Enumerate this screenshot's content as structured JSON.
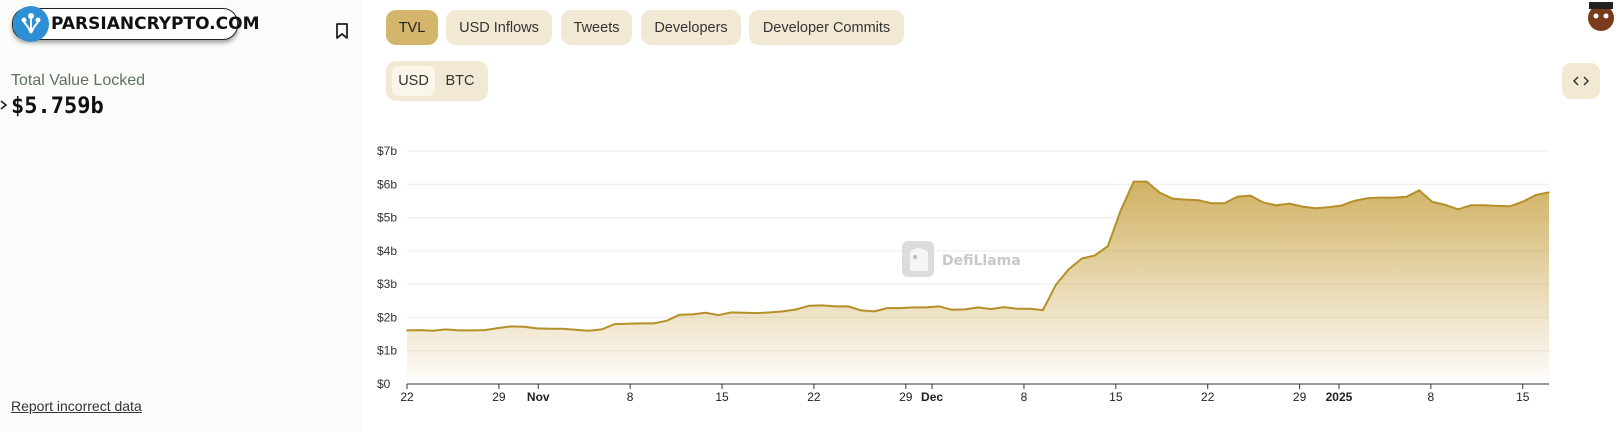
{
  "watermark": {
    "text": "PARSIANCRYPTO.COM"
  },
  "summary": {
    "label": "Total Value Locked",
    "value": "$5.759b"
  },
  "report_link": "Report incorrect data",
  "tabs": [
    {
      "label": "TVL",
      "active": true
    },
    {
      "label": "USD Inflows",
      "active": false
    },
    {
      "label": "Tweets",
      "active": false
    },
    {
      "label": "Developers",
      "active": false
    },
    {
      "label": "Developer Commits",
      "active": false
    }
  ],
  "currency": {
    "options": [
      "USD",
      "BTC"
    ],
    "selected": "USD"
  },
  "chart_watermark": "DefiLlama",
  "colors": {
    "accent": "#b68f28",
    "tab_bg": "#f1e9d3",
    "tab_active": "#d3b66c"
  },
  "chart_data": {
    "type": "area",
    "ylim": [
      0,
      7
    ],
    "y_ticks": [
      "$0",
      "$1b",
      "$2b",
      "$3b",
      "$4b",
      "$5b",
      "$6b",
      "$7b"
    ],
    "x_ticks": [
      {
        "label": "22",
        "day": 0,
        "bold": false
      },
      {
        "label": "29",
        "day": 7,
        "bold": false
      },
      {
        "label": "Nov",
        "day": 10,
        "bold": true
      },
      {
        "label": "8",
        "day": 17,
        "bold": false
      },
      {
        "label": "15",
        "day": 24,
        "bold": false
      },
      {
        "label": "22",
        "day": 31,
        "bold": false
      },
      {
        "label": "29",
        "day": 38,
        "bold": false
      },
      {
        "label": "Dec",
        "day": 40,
        "bold": true
      },
      {
        "label": "8",
        "day": 47,
        "bold": false
      },
      {
        "label": "15",
        "day": 54,
        "bold": false
      },
      {
        "label": "22",
        "day": 61,
        "bold": false
      },
      {
        "label": "29",
        "day": 68,
        "bold": false
      },
      {
        "label": "2025",
        "day": 71,
        "bold": true
      },
      {
        "label": "8",
        "day": 78,
        "bold": false
      },
      {
        "label": "15",
        "day": 85,
        "bold": false
      }
    ],
    "x_last_day": 87,
    "series": [
      {
        "values": [
          1.61,
          1.62,
          1.6,
          1.64,
          1.61,
          1.61,
          1.62,
          1.68,
          1.73,
          1.72,
          1.67,
          1.66,
          1.66,
          1.63,
          1.6,
          1.64,
          1.8,
          1.81,
          1.82,
          1.82,
          1.9,
          2.08,
          2.09,
          2.14,
          2.07,
          2.15,
          2.14,
          2.13,
          2.15,
          2.18,
          2.24,
          2.35,
          2.36,
          2.33,
          2.33,
          2.21,
          2.18,
          2.28,
          2.28,
          2.3,
          2.3,
          2.33,
          2.23,
          2.24,
          2.3,
          2.25,
          2.31,
          2.26,
          2.26,
          2.22,
          2.98,
          3.45,
          3.77,
          3.86,
          4.14,
          5.22,
          6.08,
          6.08,
          5.75,
          5.57,
          5.54,
          5.52,
          5.43,
          5.43,
          5.63,
          5.66,
          5.45,
          5.37,
          5.42,
          5.33,
          5.28,
          5.31,
          5.36,
          5.5,
          5.58,
          5.6,
          5.6,
          5.62,
          5.82,
          5.47,
          5.38,
          5.25,
          5.37,
          5.37,
          5.35,
          5.34,
          5.48,
          5.68,
          5.76
        ]
      }
    ]
  }
}
